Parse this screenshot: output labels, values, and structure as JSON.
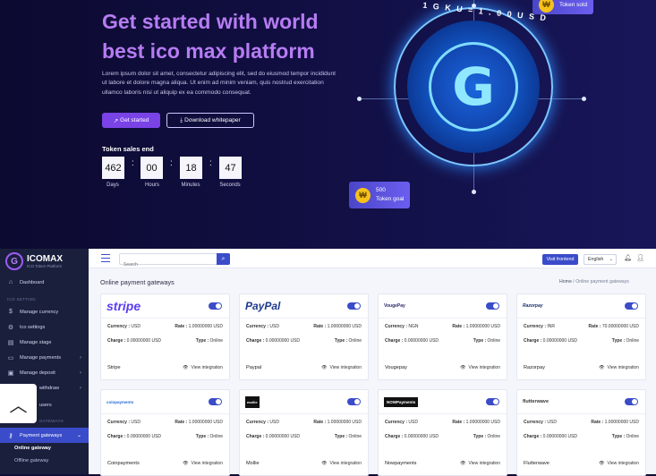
{
  "hero": {
    "title_line1": "Get started with world",
    "title_line2": "best ico max platform",
    "description": "Lorem ipsum dolor sit amet, consectetur adipiscing elit, sed do eiusmod tempor incididunt ut labore et dolore magna aliqua. Ut enim ad minim veniam, quis nostrud exercitation ullamco laboris nisi ut aliquip ex ea commodo consequat.",
    "btn_get_started": "Get started",
    "btn_whitepaper": "Download whitepaper",
    "token_sales_label": "Token sales end",
    "countdown": [
      {
        "value": "462",
        "label": "Days"
      },
      {
        "value": "00",
        "label": "Hours"
      },
      {
        "value": "18",
        "label": "Minutes"
      },
      {
        "value": "47",
        "label": "Seconds"
      }
    ],
    "coin_text": "1 G K U = 1 . 0 0 U S D",
    "token_sold_label": "Token sold",
    "token_goal_value": "500",
    "token_goal_label": "Token goal",
    "accent_color": "#b67cf3"
  },
  "admin": {
    "brand_name": "ICOMAX",
    "brand_sub": "ICO Token Platform",
    "sidebar": {
      "dashboard": "Dashboard",
      "section_ico": "ICO SETTING",
      "items": [
        "Manage currency",
        "Ico settings",
        "Manage stage",
        "Manage payments",
        "Manage deposit",
        "withdraw",
        "users"
      ],
      "section_gateway": "GATEWAYS",
      "active": "Payment gateways",
      "sub_active": "Online gateway",
      "sub_other": "Offline gateway"
    },
    "topbar": {
      "search_placeholder": "Search",
      "visit_frontend": "Visit frontend",
      "language": "English"
    },
    "page_title": "Online payment gateways",
    "breadcrumb_home": "Home",
    "breadcrumb_current": "Online payment gateways",
    "labels": {
      "currency": "Currency :",
      "rate": "Rate :",
      "charge": "Charge :",
      "type": "Type :",
      "view_integration": "View integration"
    },
    "gateways": [
      {
        "logo": "stripe",
        "currency": "USD",
        "rate": "1.00000000 USD",
        "charge": "0.00000000 USD",
        "type": "Online",
        "name": "Stripe"
      },
      {
        "logo": "PayPal",
        "currency": "USD",
        "rate": "1.00000000 USD",
        "charge": "0.00000000 USD",
        "type": "Online",
        "name": "Paypal"
      },
      {
        "logo": "VougePay",
        "currency": "NGN",
        "rate": "1.00000000 USD",
        "charge": "0.00000000 USD",
        "type": "Online",
        "name": "Vougepay"
      },
      {
        "logo": "Razorpay",
        "currency": "INR",
        "rate": "70.00000000 USD",
        "charge": "0.00000000 USD",
        "type": "Online",
        "name": "Razorpay"
      },
      {
        "logo": "coinpayments",
        "currency": "USD",
        "rate": "1.00000000 USD",
        "charge": "0.00000000 USD",
        "type": "Online",
        "name": "Coinpayments"
      },
      {
        "logo": "mollie",
        "currency": "USD",
        "rate": "1.00000000 USD",
        "charge": "0.00000000 USD",
        "type": "Online",
        "name": "Mollie"
      },
      {
        "logo": "NOWPayments",
        "currency": "USD",
        "rate": "1.00000000 USD",
        "charge": "0.00000000 USD",
        "type": "Online",
        "name": "Nowpayments"
      },
      {
        "logo": "flutterwave",
        "currency": "USD",
        "rate": "1.00000000 USD",
        "charge": "0.00000000 USD",
        "type": "Online",
        "name": "Flutterwave"
      }
    ]
  }
}
